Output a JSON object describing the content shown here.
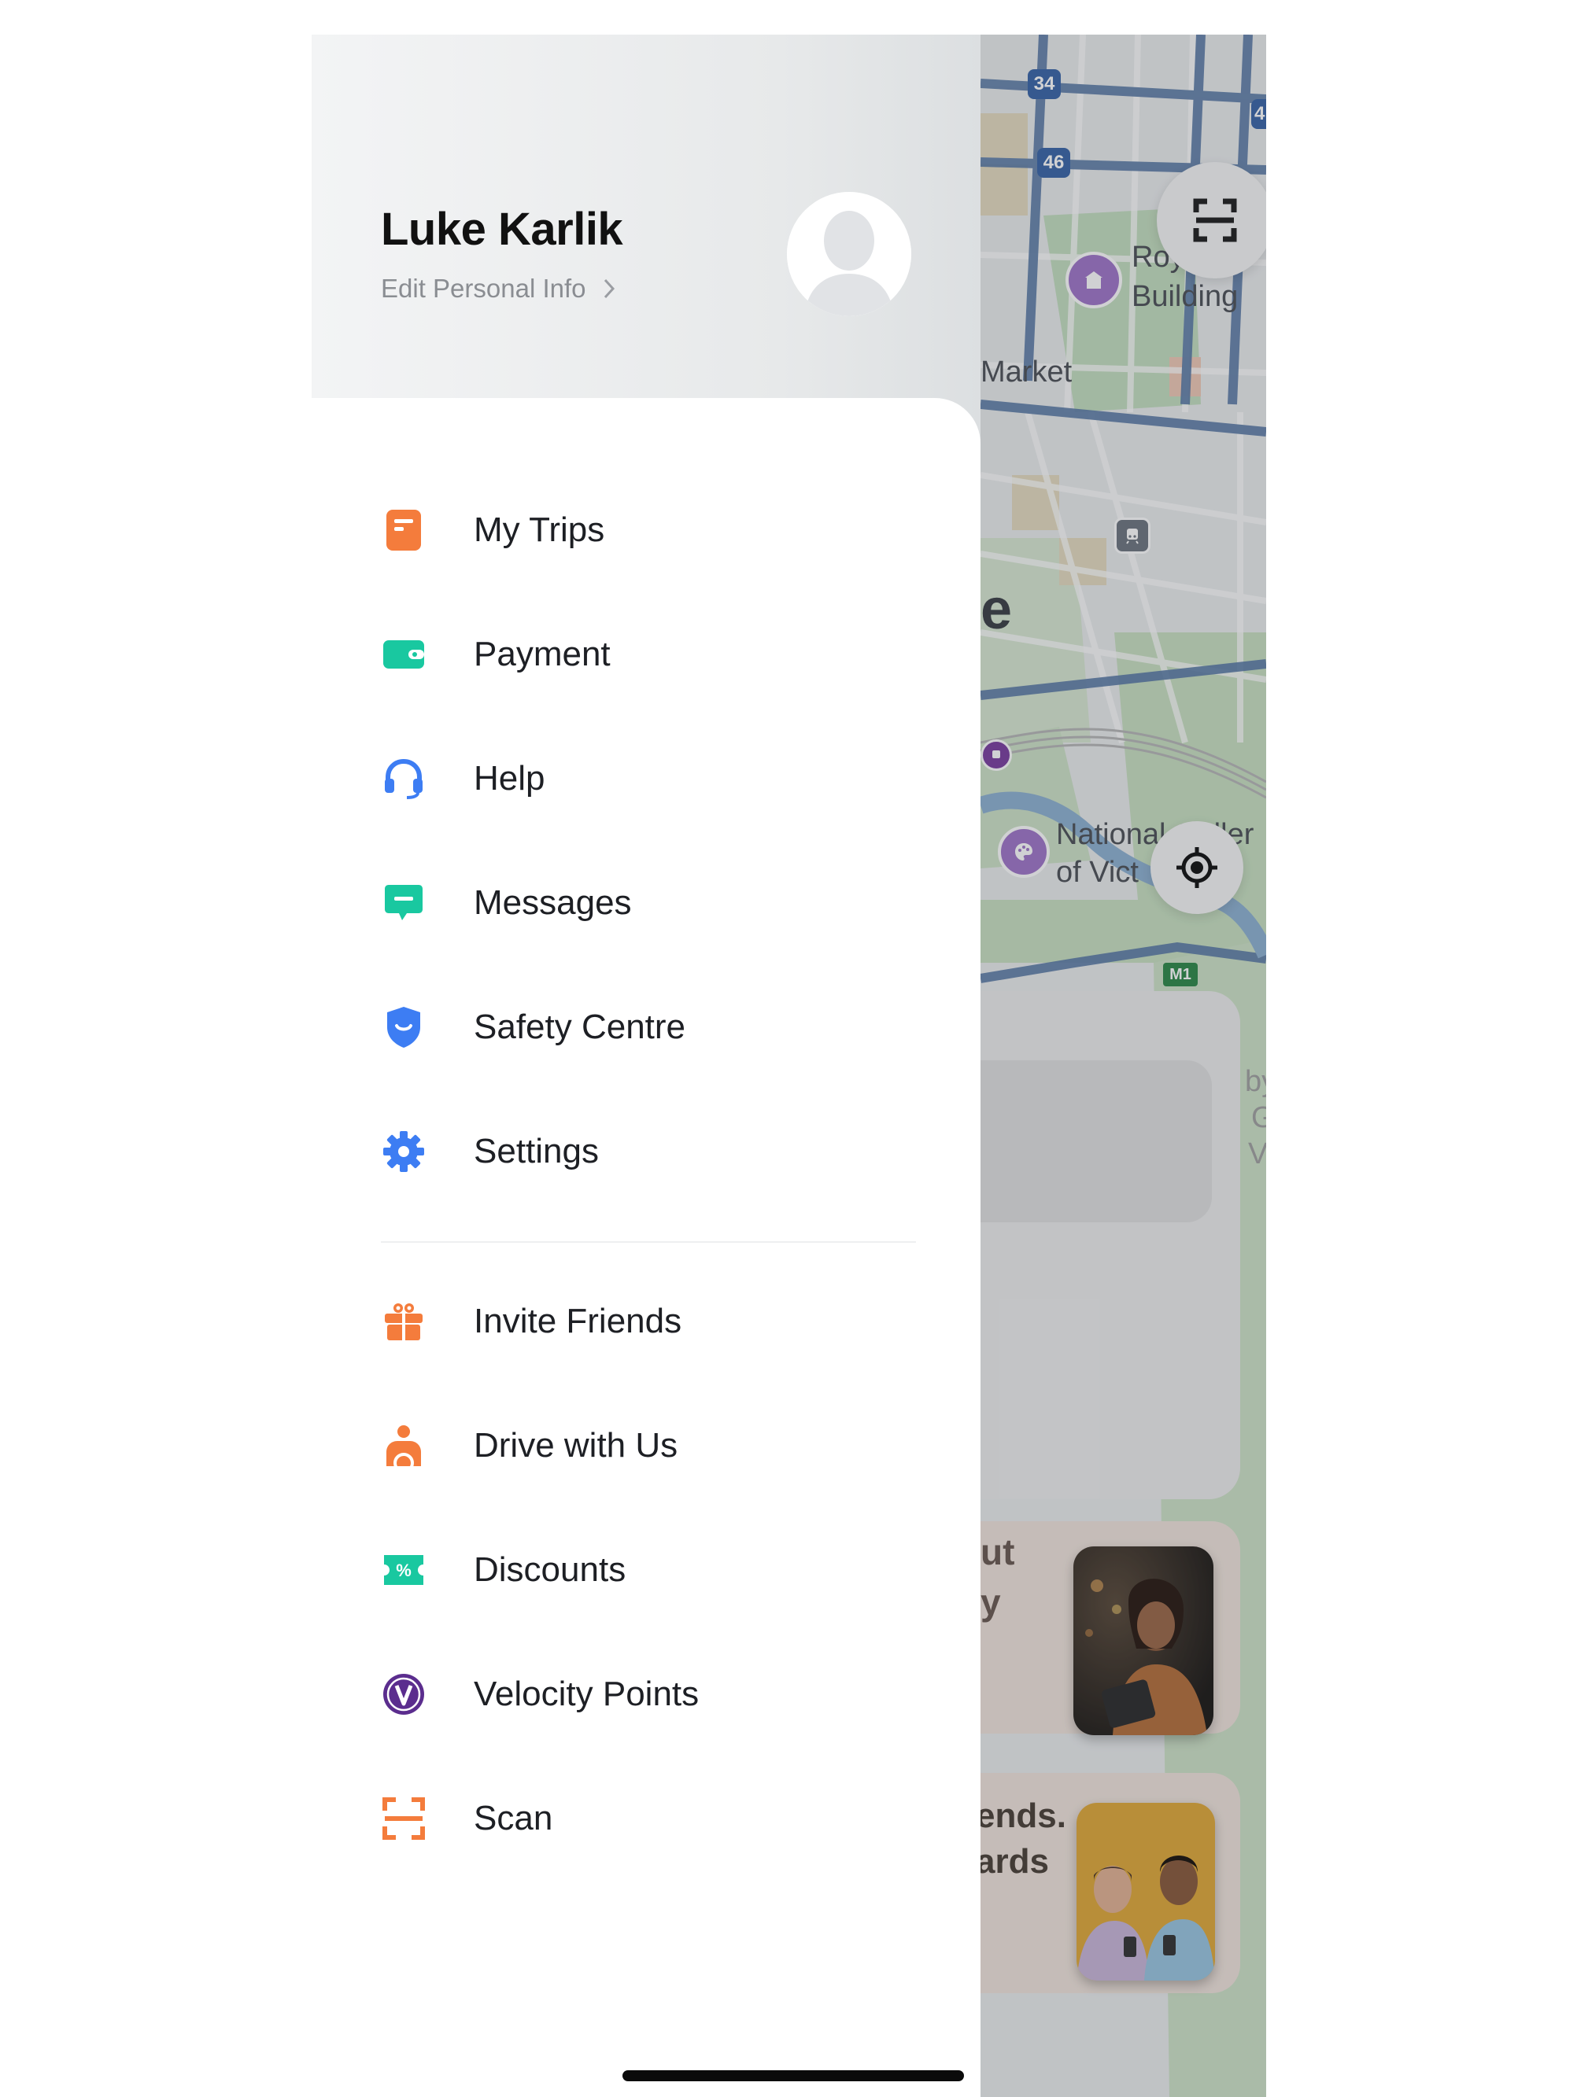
{
  "profile": {
    "name": "Luke Karlik",
    "edit_label": "Edit Personal Info"
  },
  "menu_primary": [
    {
      "label": "My Trips",
      "icon": "trips-icon",
      "color": "#F47C3C"
    },
    {
      "label": "Payment",
      "icon": "wallet-icon",
      "color": "#19C8A0"
    },
    {
      "label": "Help",
      "icon": "headset-icon",
      "color": "#3D7DF3"
    },
    {
      "label": "Messages",
      "icon": "message-icon",
      "color": "#19C8A0"
    },
    {
      "label": "Safety Centre",
      "icon": "shield-icon",
      "color": "#3D7DF3"
    },
    {
      "label": "Settings",
      "icon": "gear-icon",
      "color": "#3D7DF3"
    }
  ],
  "menu_secondary": [
    {
      "label": "Invite Friends",
      "icon": "gift-icon",
      "color": "#F47C3C"
    },
    {
      "label": "Drive with Us",
      "icon": "driver-icon",
      "color": "#F47C3C"
    },
    {
      "label": "Discounts",
      "icon": "ticket-percent-icon",
      "color": "#19C8A0"
    },
    {
      "label": "Velocity Points",
      "icon": "velocity-icon",
      "color": "#5B2D8E"
    },
    {
      "label": "Scan",
      "icon": "scan-icon",
      "color": "#F47C3C"
    }
  ],
  "map": {
    "labels": {
      "route_34": "34",
      "route_46": "46",
      "route_4": "4",
      "exhibition": "Roy. Exh",
      "building": "Building",
      "market": "Market",
      "city_fragment": "e",
      "gallery_1": "National Galler",
      "gallery_2": "of Vict",
      "m1": "M1",
      "partial_1": "by",
      "partial_2": "G",
      "partial_3": "Vi"
    },
    "icons": [
      "scan-icon",
      "locate-icon",
      "landmark-icon",
      "train-icon",
      "tram-icon",
      "palette-icon"
    ]
  },
  "promos": {
    "card1_line1": "ut",
    "card1_line2": "y",
    "card2_line1": "ends.",
    "card2_line2": "ards"
  }
}
